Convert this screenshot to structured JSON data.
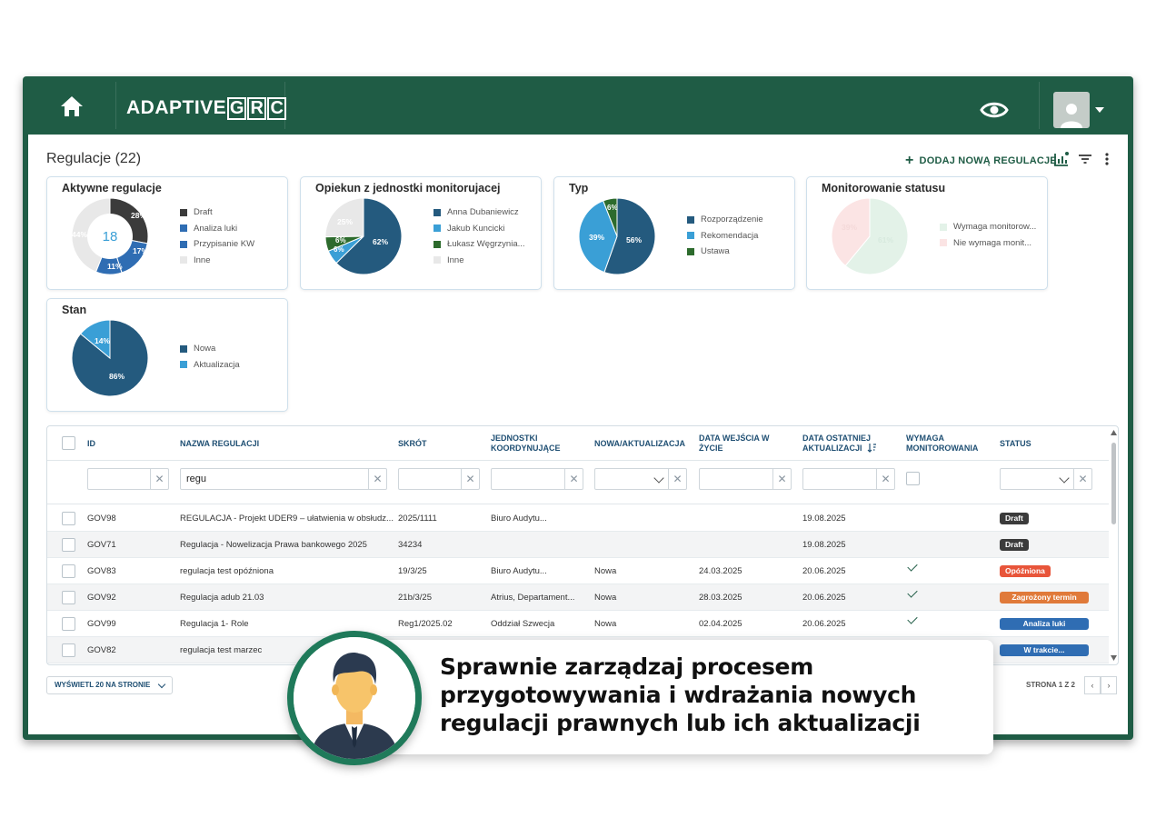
{
  "brand": {
    "logo_text": "ADAPTIVE",
    "logo_letters": [
      "G",
      "R",
      "C"
    ]
  },
  "page": {
    "title": "Regulacje (22)",
    "add_button": "DODAJ NOWĄ REGULACJĘ"
  },
  "colors": {
    "brand_green": "#1f5c45",
    "dark_blue": "#245a7e",
    "mid_blue": "#2f6db3",
    "light_blue": "#3a9fd6",
    "green": "#2d6b2d",
    "dark": "#3b3b3b",
    "light_gray": "#e8e8e8"
  },
  "cards": [
    {
      "title": "Aktywne regulacje",
      "center": "18",
      "legend": [
        "Draft",
        "Analiza luki",
        "Przypisanie KW",
        "Inne"
      ],
      "labels": [
        "28%",
        "17%",
        "11%",
        "44%"
      ]
    },
    {
      "title": "Opiekun z jednostki monitorujacej",
      "legend": [
        "Anna Dubaniewicz",
        "Jakub Kuncicki",
        "Łukasz Węgrzynia...",
        "Inne"
      ],
      "labels": [
        "62%",
        "6%",
        "6%",
        "25%"
      ]
    },
    {
      "title": "Typ",
      "legend": [
        "Rozporządzenie",
        "Rekomendacja",
        "Ustawa"
      ],
      "labels": [
        "56%",
        "39%",
        "6%"
      ]
    },
    {
      "title": "Monitorowanie statusu",
      "legend": [
        "Wymaga monitorow...",
        "Nie wymaga monit..."
      ],
      "labels": [
        "61%",
        "39%"
      ]
    },
    {
      "title": "Stan",
      "legend": [
        "Nowa",
        "Aktualizacja"
      ],
      "labels": [
        "86%",
        "14%"
      ]
    }
  ],
  "chart_data": [
    {
      "type": "pie",
      "title": "Aktywne regulacje",
      "categories": [
        "Draft",
        "Analiza luki",
        "Przypisanie KW",
        "Inne"
      ],
      "values": [
        28,
        17,
        11,
        44
      ]
    },
    {
      "type": "pie",
      "title": "Opiekun z jednostki monitorujacej",
      "categories": [
        "Anna Dubaniewicz",
        "Jakub Kuncicki",
        "Łukasz Węgrzynia...",
        "Inne"
      ],
      "values": [
        62,
        6,
        6,
        25
      ]
    },
    {
      "type": "pie",
      "title": "Typ",
      "categories": [
        "Rozporządzenie",
        "Rekomendacja",
        "Ustawa"
      ],
      "values": [
        56,
        39,
        6
      ]
    },
    {
      "type": "pie",
      "title": "Monitorowanie statusu",
      "categories": [
        "Wymaga monitorow...",
        "Nie wymaga monit..."
      ],
      "values": [
        61,
        39
      ]
    },
    {
      "type": "pie",
      "title": "Stan",
      "categories": [
        "Nowa",
        "Aktualizacja"
      ],
      "values": [
        86,
        14
      ]
    }
  ],
  "table": {
    "headers": [
      "ID",
      "NAZWA REGULACJI",
      "SKRÓT",
      "JEDNOSTKI\nKOORDYNUJĄCE",
      "NOWA/AKTUALIZACJA",
      "DATA WEJŚCIA W\nŻYCIE",
      "DATA OSTATNIEJ\nAKTUALIZACJI",
      "WYMAGA\nMONITOROWANIA",
      "STATUS"
    ],
    "filter_name_value": "regu",
    "rows": [
      {
        "id": "GOV98",
        "name": "REGULACJA - Projekt UDER9 – ułatwienia w obsłudz...",
        "short": "2025/1111",
        "units": "Biuro Audytu...",
        "type": "",
        "date_in": "",
        "date_upd": "19.08.2025",
        "monitor": false,
        "status": "Draft",
        "status_color": "#3b3b3b"
      },
      {
        "id": "GOV71",
        "name": "Regulacja - Nowelizacja Prawa bankowego 2025",
        "short": "34234",
        "units": "",
        "type": "",
        "date_in": "",
        "date_upd": "19.08.2025",
        "monitor": false,
        "status": "Draft",
        "status_color": "#3b3b3b"
      },
      {
        "id": "GOV83",
        "name": "regulacja test opóźniona",
        "short": "19/3/25",
        "units": "Biuro Audytu...",
        "type": "Nowa",
        "date_in": "24.03.2025",
        "date_upd": "20.06.2025",
        "monitor": true,
        "status": "Opóźniona",
        "status_color": "#e8553a"
      },
      {
        "id": "GOV92",
        "name": "Regulacja adub 21.03",
        "short": "21b/3/25",
        "units": "Atrius, Departament...",
        "type": "Nowa",
        "date_in": "28.03.2025",
        "date_upd": "20.06.2025",
        "monitor": true,
        "status": "Zagrożony termin",
        "status_color": "#e07a3a"
      },
      {
        "id": "GOV99",
        "name": "Regulacja 1- Role",
        "short": "Reg1/2025.02",
        "units": "Oddział Szwecja",
        "type": "Nowa",
        "date_in": "02.04.2025",
        "date_upd": "20.06.2025",
        "monitor": true,
        "status": "Analiza luki",
        "status_color": "#2f6db3"
      },
      {
        "id": "GOV82",
        "name": "regulacja test marzec",
        "short": "",
        "units": "",
        "type": "",
        "date_in": "",
        "date_upd": "",
        "monitor": false,
        "status": "W trakcie...",
        "status_color": "#2f6db3"
      }
    ]
  },
  "pager": {
    "per_page": "WYŚWIETL 20 NA STRONIE",
    "page_info": "STRONA 1 Z 2",
    "prev": "‹",
    "next": "›"
  },
  "callout": {
    "text": "Sprawnie zarządzaj procesem przygotowywania i wdrażania nowych regulacji prawnych lub ich aktualizacji"
  }
}
